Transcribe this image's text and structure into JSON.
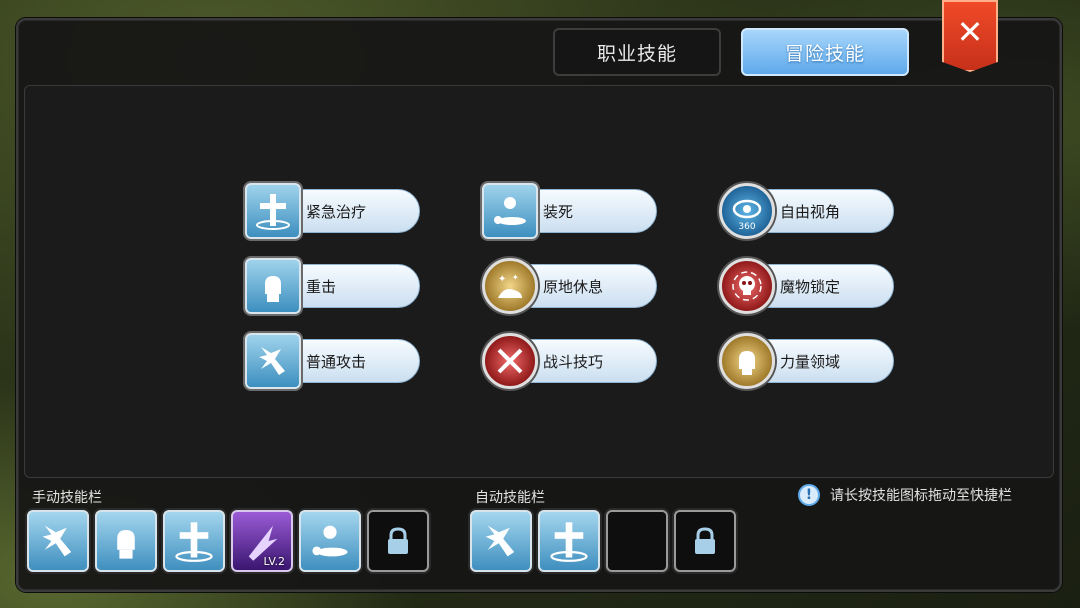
{
  "tabs": [
    {
      "label": "职业技能",
      "active": false
    },
    {
      "label": "冒险技能",
      "active": true
    }
  ],
  "close_icon": "close-icon",
  "skills": [
    {
      "label": "紧急治疗",
      "icon": "healing-cross-icon"
    },
    {
      "label": "装死",
      "icon": "play-dead-icon"
    },
    {
      "label": "自由视角",
      "icon": "free-view-eye-icon",
      "badge": "360"
    },
    {
      "label": "重击",
      "icon": "heavy-strike-fist-icon"
    },
    {
      "label": "原地休息",
      "icon": "rest-icon"
    },
    {
      "label": "魔物锁定",
      "icon": "monster-lock-skull-icon"
    },
    {
      "label": "普通攻击",
      "icon": "normal-attack-sword-icon"
    },
    {
      "label": "战斗技巧",
      "icon": "combat-skill-swords-icon"
    },
    {
      "label": "力量领域",
      "icon": "power-field-fist-icon"
    }
  ],
  "manual_bar": {
    "label": "手动技能栏",
    "slots": [
      {
        "icon": "normal-attack-sword-icon"
      },
      {
        "icon": "heavy-strike-fist-icon"
      },
      {
        "icon": "healing-cross-icon"
      },
      {
        "icon": "purple-slash-icon",
        "level": "LV.2"
      },
      {
        "icon": "play-dead-icon"
      },
      {
        "icon": "lock-icon",
        "locked": true
      }
    ]
  },
  "auto_bar": {
    "label": "自动技能栏",
    "slots": [
      {
        "icon": "normal-attack-sword-icon"
      },
      {
        "icon": "healing-cross-icon"
      },
      {
        "icon": "empty-slot"
      },
      {
        "icon": "lock-icon",
        "locked": true
      }
    ]
  },
  "hint": {
    "icon": "info-icon",
    "text": "请长按技能图标拖动至快捷栏"
  },
  "colors": {
    "accent_blue": "#5ea9ea",
    "close_red": "#e2401f",
    "panel_bg": "#161616"
  }
}
